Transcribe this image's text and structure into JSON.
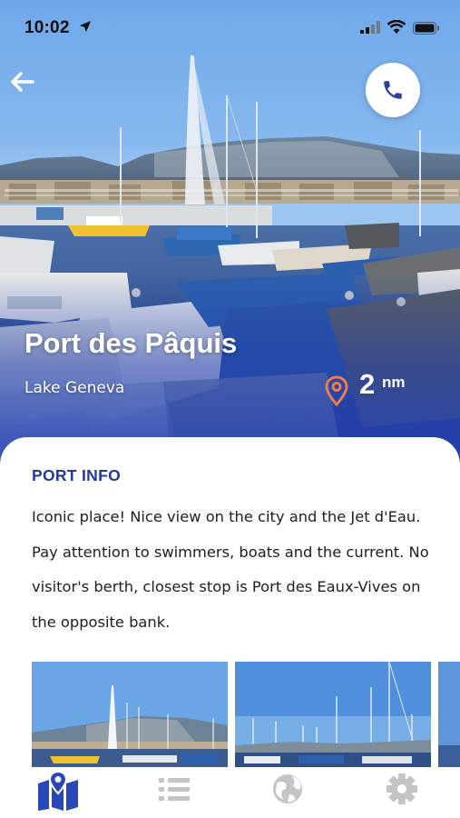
{
  "status_bar": {
    "time": "10:02",
    "icons": [
      "location-arrow-icon",
      "cellular-signal-icon",
      "wifi-icon",
      "battery-icon"
    ]
  },
  "header": {
    "back_icon": "arrow-left-icon",
    "call_icon": "phone-icon"
  },
  "port": {
    "name": "Port des Pâquis",
    "location": "Lake Geneva",
    "distance_value": "2",
    "distance_unit": "nm",
    "distance_icon": "map-pin-icon"
  },
  "port_info": {
    "heading": "PORT INFO",
    "description": "Iconic place! Nice view on the city and the Jet d'Eau. Pay attention to swimmers, boats and the current. No visitor's berth, closest stop is Port des Eaux-Vives on the opposite bank."
  },
  "gallery": {
    "count_visible": 3
  },
  "tab_bar": {
    "tabs": [
      {
        "icon": "map-icon",
        "active": true
      },
      {
        "icon": "list-icon",
        "active": false
      },
      {
        "icon": "globe-icon",
        "active": false
      },
      {
        "icon": "gear-icon",
        "active": false
      }
    ]
  },
  "colors": {
    "accent": "#22389a",
    "hero_blue": "#2f4fbf",
    "pin_orange": "#ef7a4a",
    "tab_inactive": "#c4c4c4",
    "text": "#1e1e1e"
  }
}
